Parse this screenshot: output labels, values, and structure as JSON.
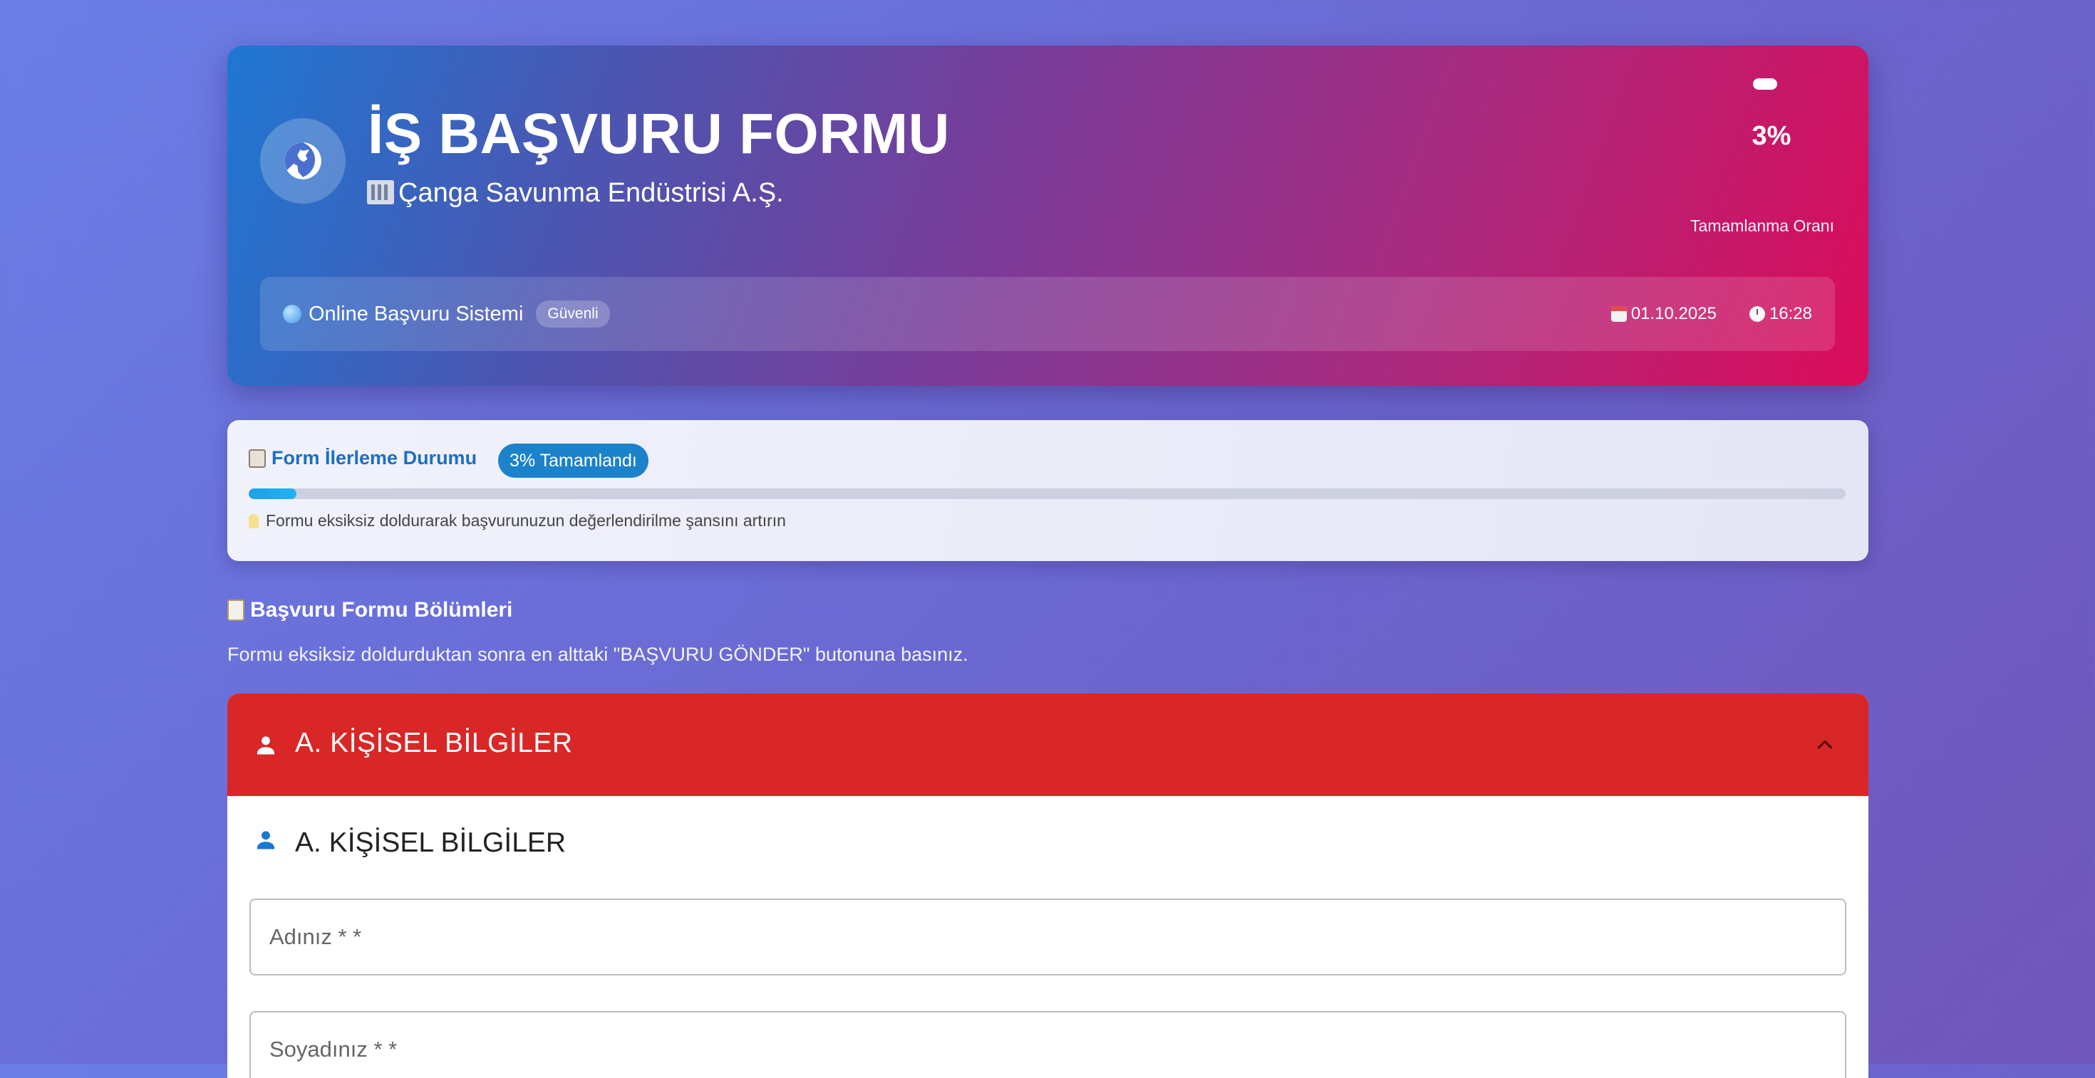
{
  "header": {
    "title": "İŞ BAŞVURU FORMU",
    "company": "Çanga Savunma Endüstrisi A.Ş.",
    "completion_percent": "3%",
    "completion_label": "Tamamlanma Oranı",
    "system_label": "Online Başvuru Sistemi",
    "secure_badge": "Güvenli",
    "date": "01.10.2025",
    "time": "16:28"
  },
  "progress": {
    "title": "Form İlerleme Durumu",
    "chip": "3% Tamamlandı",
    "value": 0.03,
    "tip": "Formu eksiksiz doldurarak başvurunuzun değerlendirilme şansını artırın"
  },
  "sections": {
    "title": "Başvuru Formu Bölümleri",
    "subtitle": "Formu eksiksiz doldurduktan sonra en alttaki \"BAŞVURU GÖNDER\" butonuna basınız."
  },
  "personal": {
    "header_title": "A. KİŞİSEL BİLGİLER",
    "body_title": "A. KİŞİSEL BİLGİLER",
    "first_name_placeholder": "Adınız * *",
    "last_name_placeholder": "Soyadınız * *"
  },
  "colors": {
    "header_gradient_start": "#1e77d2",
    "header_gradient_end": "#db0c5a",
    "section_header": "#d92727",
    "accent_blue": "#1c82c9"
  },
  "icons": {
    "logo": "globe-icon",
    "section": "person-icon",
    "toggle": "chevron-up-icon"
  }
}
